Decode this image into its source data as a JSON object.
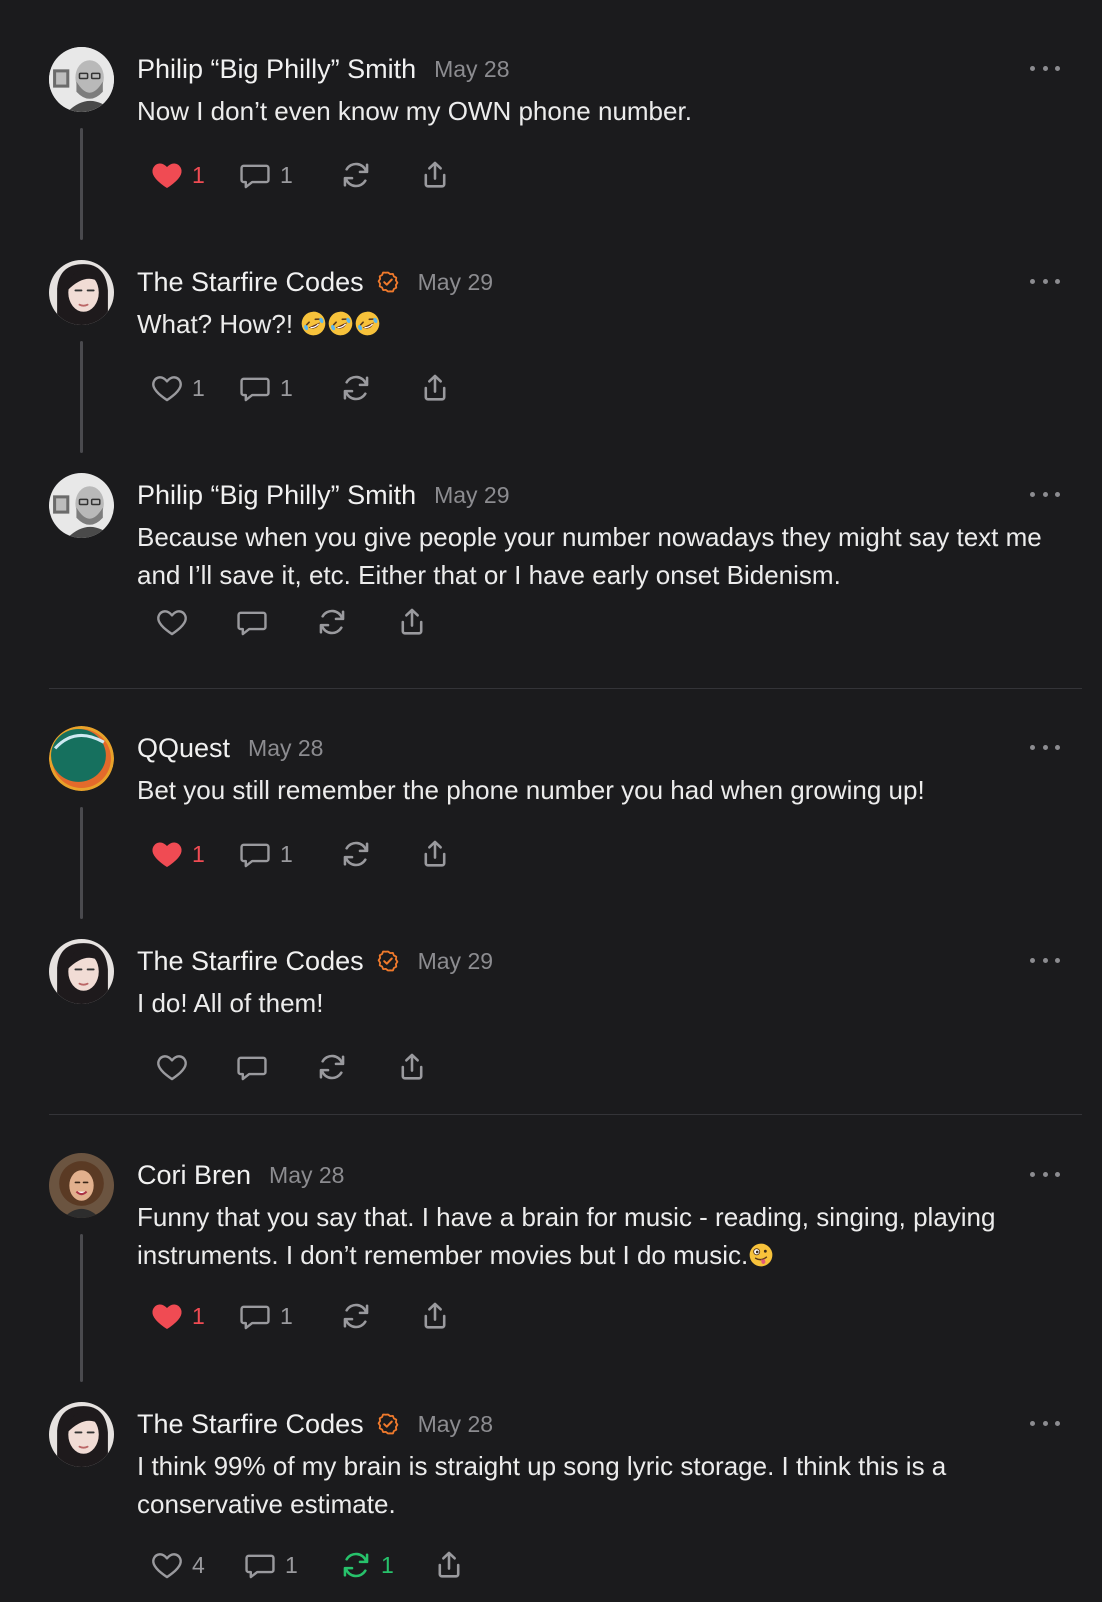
{
  "colors": {
    "background": "#1b1b1d",
    "heart_liked": "#f04b53",
    "repost_active": "#27c26b",
    "verified_badge": "#f07a2c",
    "thread_line": "#4a4a4e"
  },
  "posts": [
    {
      "author": "Philip “Big Philly” Smith",
      "date": "May 28",
      "text": "Now I don’t even know my OWN phone number.",
      "likes": "1",
      "replies": "1",
      "liked": true
    },
    {
      "author": "The Starfire Codes",
      "verified": true,
      "date": "May 29",
      "text": "What? How?!",
      "emoji": "rolling-on-floor-laughing x3",
      "likes": "1",
      "replies": "1"
    },
    {
      "author": "Philip “Big Philly” Smith",
      "date": "May 29",
      "text": "Because when you give people your number nowadays they might say text me and I’ll save it, etc. Either that or I have early onset Bidenism."
    },
    {
      "author": "QQuest",
      "date": "May 28",
      "text": "Bet you still remember the phone number you had when growing up!",
      "likes": "1",
      "replies": "1",
      "liked": true
    },
    {
      "author": "The Starfire Codes",
      "verified": true,
      "date": "May 29",
      "text": "I do! All of them!"
    },
    {
      "author": "Cori Bren",
      "date": "May 28",
      "text": "Funny that you say that. I have a brain for music - reading, singing, playing instruments. I don’t remember movies but I do music.",
      "emoji": "zany-face",
      "likes": "1",
      "replies": "1",
      "liked": true
    },
    {
      "author": "The Starfire Codes",
      "verified": true,
      "date": "May 28",
      "text": "I think 99% of my brain is straight up song lyric storage. I think this is a conservative estimate.",
      "likes": "4",
      "replies": "1",
      "reposts": "1",
      "reposted": true
    }
  ]
}
